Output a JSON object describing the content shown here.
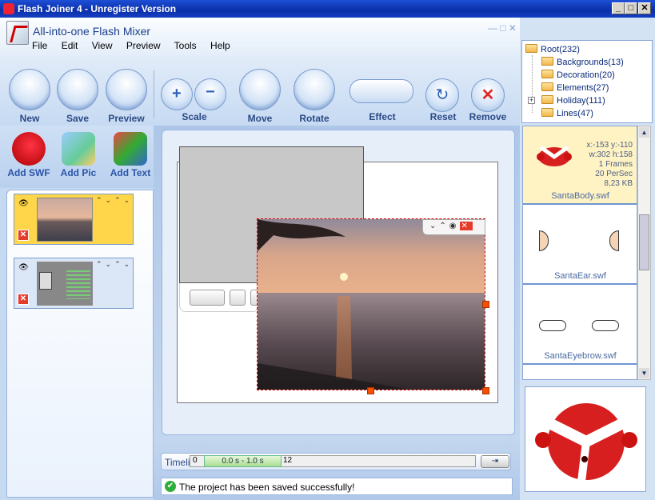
{
  "window": {
    "title": "Flash Joiner 4 - Unregister Version"
  },
  "app": {
    "subtitle": "All-into-one Flash Mixer"
  },
  "menu": [
    "File",
    "Edit",
    "View",
    "Preview",
    "Tools",
    "Help"
  ],
  "toolbar": {
    "new": "New",
    "save": "Save",
    "preview": "Preview",
    "scale": "Scale",
    "move": "Move",
    "rotate": "Rotate",
    "effect": "Effect",
    "reset": "Reset",
    "remove": "Remove"
  },
  "add": {
    "swf": "Add SWF",
    "pic": "Add Pic",
    "text": "Add Text"
  },
  "tree": [
    {
      "label": "Root(232)"
    },
    {
      "label": "Backgrounds(13)"
    },
    {
      "label": "Decoration(20)"
    },
    {
      "label": "Elements(27)"
    },
    {
      "label": "Holiday(111)"
    },
    {
      "label": "Lines(47)"
    }
  ],
  "library": {
    "selected": {
      "coords": "x:-153 y:-110",
      "size": "w:302 h:158",
      "frames": "1 Frames",
      "rate": "20 PerSec",
      "filesize": "8,23 KB"
    },
    "items": [
      {
        "name": "SantaBody.swf"
      },
      {
        "name": "SantaEar.swf"
      },
      {
        "name": "SantaEyebrow.swf"
      }
    ]
  },
  "timeline": {
    "label": "Timeline",
    "start": "0",
    "range": "0.0 s - 1.0 s",
    "end": "12"
  },
  "status": {
    "message": "The project has been saved successfully!"
  },
  "colors": {
    "accent": "#1e4fd6",
    "selected_layer": "#ffd64a",
    "handle": "#f55000"
  }
}
